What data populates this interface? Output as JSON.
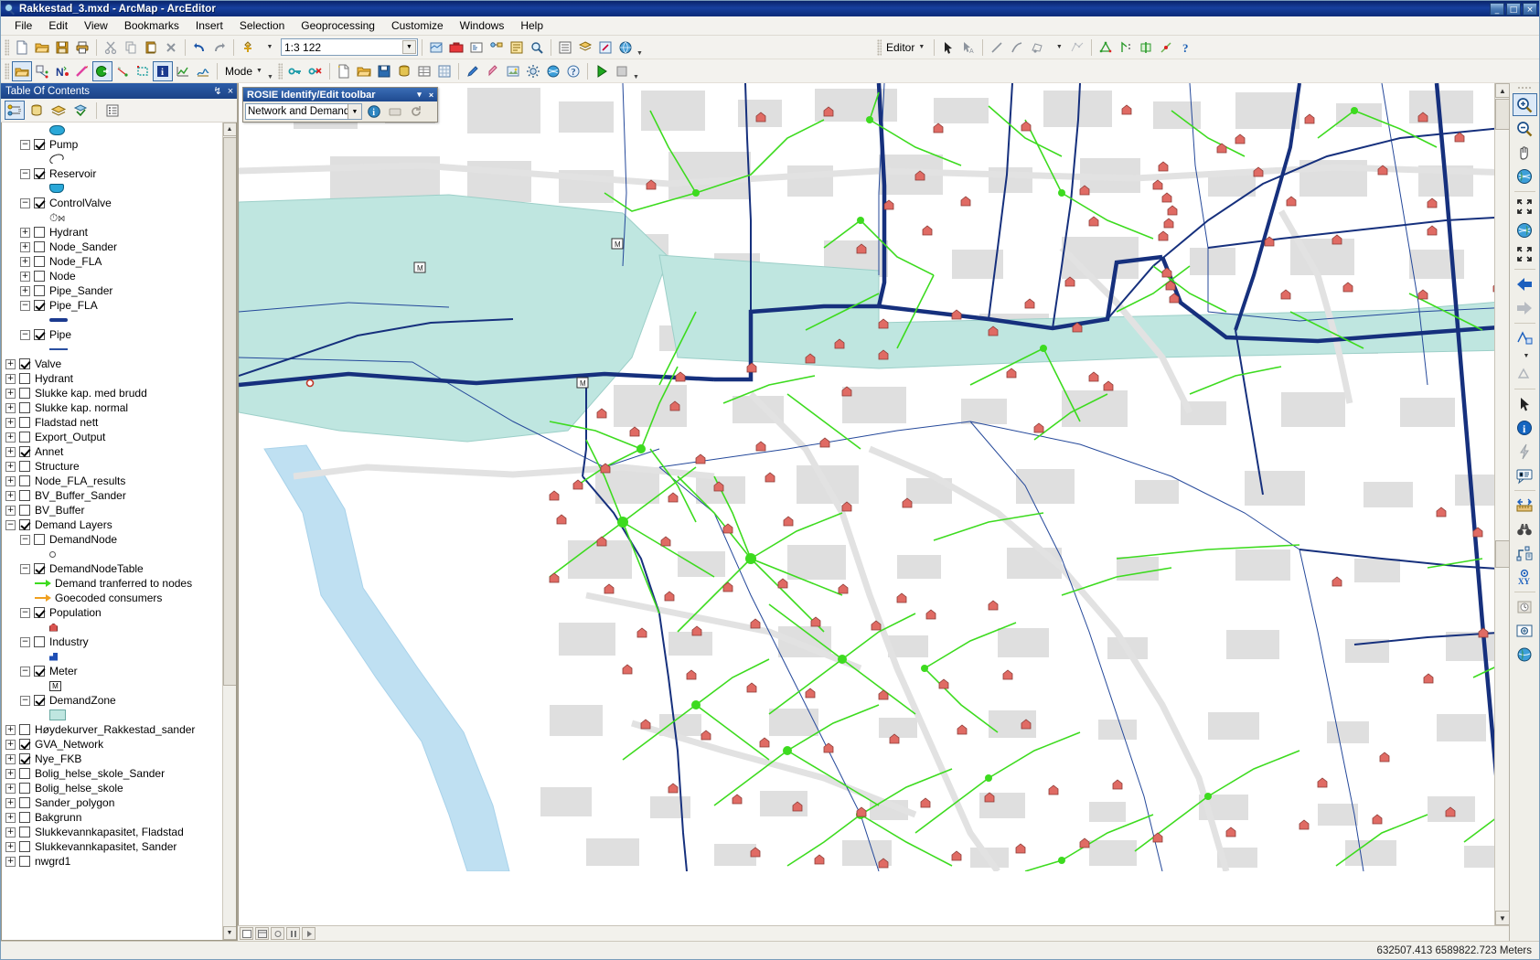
{
  "window": {
    "title": "Rakkestad_3.mxd - ArcMap - ArcEditor",
    "minimize": "_",
    "maximize": "□",
    "close": "×"
  },
  "menubar": {
    "items": [
      {
        "label": "File"
      },
      {
        "label": "Edit"
      },
      {
        "label": "View"
      },
      {
        "label": "Bookmarks"
      },
      {
        "label": "Insert"
      },
      {
        "label": "Selection"
      },
      {
        "label": "Geoprocessing"
      },
      {
        "label": "Customize"
      },
      {
        "label": "Windows"
      },
      {
        "label": "Help"
      }
    ]
  },
  "standard_toolbar": {
    "scale_value": "1:3 122",
    "buttons": [
      {
        "name": "new-document-icon"
      },
      {
        "name": "open-document-icon"
      },
      {
        "name": "save-icon"
      },
      {
        "name": "print-icon"
      },
      {
        "name": "cut-icon"
      },
      {
        "name": "copy-icon"
      },
      {
        "name": "paste-icon"
      },
      {
        "name": "delete-icon"
      },
      {
        "name": "undo-icon"
      },
      {
        "name": "redo-icon"
      },
      {
        "name": "add-data-icon"
      }
    ]
  },
  "editor_toolbar": {
    "editor_label": "Editor",
    "buttons": [
      {
        "name": "edit-tool-icon"
      },
      {
        "name": "edit-annotation-icon"
      },
      {
        "name": "straight-segment-icon"
      },
      {
        "name": "endpoint-arc-icon"
      },
      {
        "name": "trace-icon"
      },
      {
        "name": "sketch-properties-icon"
      },
      {
        "name": "edit-vertices-icon"
      },
      {
        "name": "reshape-feature-icon"
      },
      {
        "name": "cut-polygons-icon"
      },
      {
        "name": "split-icon"
      },
      {
        "name": "editor-help-icon"
      }
    ]
  },
  "rosie_toolbar": {
    "mode_label": "Mode",
    "buttons": [
      {
        "name": "open-network-icon"
      },
      {
        "name": "network-edit-icon"
      },
      {
        "name": "node-tool-icon"
      },
      {
        "name": "demand-tool-icon"
      },
      {
        "name": "run-export-icon"
      },
      {
        "name": "link-tool-icon"
      },
      {
        "name": "zone-tool-icon"
      },
      {
        "name": "info-tool-icon"
      },
      {
        "name": "chart-tool-icon"
      },
      {
        "name": "profile-tool-icon"
      }
    ],
    "second_group": [
      {
        "name": "key-icon"
      },
      {
        "name": "key-delete-icon"
      },
      {
        "name": "new-file-icon"
      },
      {
        "name": "open-folder-icon"
      },
      {
        "name": "save-as-icon"
      },
      {
        "name": "database-icon"
      },
      {
        "name": "table-icon"
      },
      {
        "name": "grid-icon"
      },
      {
        "name": "pencil-icon"
      },
      {
        "name": "marker-icon"
      },
      {
        "name": "image-icon"
      },
      {
        "name": "settings-icon"
      },
      {
        "name": "globe-icon"
      },
      {
        "name": "help-icon"
      },
      {
        "name": "run-icon"
      },
      {
        "name": "stop-icon"
      }
    ]
  },
  "toc": {
    "title": "Table Of Contents",
    "pin_icon": "↯",
    "close_icon": "×",
    "tabs": [
      {
        "name": "list-by-drawing-order",
        "selected": true
      },
      {
        "name": "list-by-source",
        "selected": false
      },
      {
        "name": "list-by-visibility",
        "selected": false
      },
      {
        "name": "list-by-selection",
        "selected": false
      },
      {
        "name": "options",
        "selected": false
      }
    ],
    "items": [
      {
        "label": "",
        "symbol": "pump-symbol",
        "kind": "symbol",
        "indent": 3
      },
      {
        "label": "Pump",
        "expander": "minus",
        "checked": true,
        "indent": 1
      },
      {
        "label": "",
        "symbol": "reservoir-symbol",
        "kind": "symbol",
        "indent": 3
      },
      {
        "label": "Reservoir",
        "expander": "minus",
        "checked": true,
        "indent": 1
      },
      {
        "label": "",
        "symbol": "controlvalve-symbol",
        "kind": "symbol",
        "indent": 3
      },
      {
        "label": "ControlValve",
        "expander": "minus",
        "checked": true,
        "indent": 1
      },
      {
        "label": "",
        "symbol": "bowtie-symbol",
        "kind": "symbol",
        "indent": 3
      },
      {
        "label": "Hydrant",
        "expander": "plus",
        "checked": false,
        "indent": 1
      },
      {
        "label": "Node_Sander",
        "expander": "plus",
        "checked": false,
        "indent": 1
      },
      {
        "label": "Node_FLA",
        "expander": "plus",
        "checked": false,
        "indent": 1
      },
      {
        "label": "Node",
        "expander": "plus",
        "checked": false,
        "indent": 1
      },
      {
        "label": "Pipe_Sander",
        "expander": "plus",
        "checked": false,
        "indent": 1
      },
      {
        "label": "Pipe_FLA",
        "expander": "minus",
        "checked": true,
        "indent": 1
      },
      {
        "label": "",
        "symbol": "pipe-fla-symbol",
        "kind": "symbol",
        "indent": 3
      },
      {
        "label": "Pipe",
        "expander": "minus",
        "checked": true,
        "indent": 1
      },
      {
        "label": "",
        "symbol": "pipe-symbol",
        "kind": "symbol",
        "indent": 3
      },
      {
        "label": "Valve",
        "expander": "plus",
        "checked": true,
        "indent": 0
      },
      {
        "label": "Hydrant",
        "expander": "plus",
        "checked": false,
        "indent": 0
      },
      {
        "label": "Slukke kap. med brudd",
        "expander": "plus",
        "checked": false,
        "indent": 0
      },
      {
        "label": "Slukke kap. normal",
        "expander": "plus",
        "checked": false,
        "indent": 0
      },
      {
        "label": "Fladstad nett",
        "expander": "plus",
        "checked": false,
        "indent": 0
      },
      {
        "label": "Export_Output",
        "expander": "plus",
        "checked": false,
        "indent": 0
      },
      {
        "label": "Annet",
        "expander": "plus",
        "checked": true,
        "indent": 0
      },
      {
        "label": "Structure",
        "expander": "plus",
        "checked": false,
        "indent": 0
      },
      {
        "label": "Node_FLA_results",
        "expander": "plus",
        "checked": false,
        "indent": 0
      },
      {
        "label": "BV_Buffer_Sander",
        "expander": "plus",
        "checked": false,
        "indent": 0
      },
      {
        "label": "BV_Buffer",
        "expander": "plus",
        "checked": false,
        "indent": 0
      },
      {
        "label": "Demand Layers",
        "expander": "minus",
        "checked": true,
        "indent": 0
      },
      {
        "label": "DemandNode",
        "expander": "minus",
        "checked": false,
        "indent": 1
      },
      {
        "label": "",
        "symbol": "circle-symbol",
        "kind": "symbol",
        "indent": 3
      },
      {
        "label": "DemandNodeTable",
        "expander": "minus",
        "checked": true,
        "indent": 1
      },
      {
        "label": "Demand tranferred to nodes",
        "kind": "legend",
        "symbol": "green-arrow-symbol",
        "indent": 2
      },
      {
        "label": "Goecoded consumers",
        "kind": "legend",
        "symbol": "orange-arrow-symbol",
        "indent": 2
      },
      {
        "label": "Population",
        "expander": "minus",
        "checked": true,
        "indent": 1
      },
      {
        "label": "",
        "symbol": "house-symbol",
        "kind": "symbol",
        "indent": 3
      },
      {
        "label": "Industry",
        "expander": "minus",
        "checked": false,
        "indent": 1
      },
      {
        "label": "",
        "symbol": "industry-symbol",
        "kind": "symbol",
        "indent": 3
      },
      {
        "label": "Meter",
        "expander": "minus",
        "checked": true,
        "indent": 1
      },
      {
        "label": "",
        "symbol": "meter-symbol",
        "kind": "symbol",
        "indent": 3
      },
      {
        "label": "DemandZone",
        "expander": "minus",
        "checked": true,
        "indent": 1
      },
      {
        "label": "",
        "symbol": "zone-symbol",
        "kind": "symbol",
        "indent": 3
      },
      {
        "label": "Høydekurver_Rakkestad_sander",
        "expander": "plus",
        "checked": false,
        "indent": 0
      },
      {
        "label": "GVA_Network",
        "expander": "plus",
        "checked": true,
        "indent": 0
      },
      {
        "label": "Nye_FKB",
        "expander": "plus",
        "checked": true,
        "indent": 0
      },
      {
        "label": "Bolig_helse_skole_Sander",
        "expander": "plus",
        "checked": false,
        "indent": 0
      },
      {
        "label": "Bolig_helse_skole",
        "expander": "plus",
        "checked": false,
        "indent": 0
      },
      {
        "label": "Sander_polygon",
        "expander": "plus",
        "checked": false,
        "indent": 0
      },
      {
        "label": "Bakgrunn",
        "expander": "plus",
        "checked": false,
        "indent": 0
      },
      {
        "label": "Slukkevannkapasitet, Fladstad",
        "expander": "plus",
        "checked": false,
        "indent": 0
      },
      {
        "label": "Slukkevannkapasitet, Sander",
        "expander": "plus",
        "checked": false,
        "indent": 0
      },
      {
        "label": "nwgrd1",
        "expander": "plus",
        "checked": false,
        "indent": 0
      }
    ]
  },
  "rosie_float": {
    "title": "ROSIE Identify/Edit  toolbar",
    "minimize_icon": "▾",
    "close_icon": "×",
    "layer_selector_value": "Network and Demand layer",
    "buttons": [
      {
        "name": "identify-icon"
      },
      {
        "name": "edit-attributes-icon"
      },
      {
        "name": "refresh-icon"
      }
    ]
  },
  "right_palette": {
    "tools": [
      {
        "name": "zoom-in-icon",
        "selected": true
      },
      {
        "name": "zoom-out-icon",
        "selected": false
      },
      {
        "name": "pan-icon",
        "selected": false
      },
      {
        "name": "full-extent-globe-icon",
        "selected": false
      },
      {
        "name": "fixed-zoom-in-icon",
        "selected": false
      },
      {
        "name": "globe-extent-icon",
        "selected": false
      },
      {
        "name": "fixed-zoom-out-icon",
        "selected": false
      },
      {
        "name": "go-back-extent-icon",
        "selected": false
      },
      {
        "name": "go-forward-extent-icon",
        "selected": false
      },
      {
        "name": "select-features-icon",
        "selected": false
      },
      {
        "name": "clear-selection-icon",
        "selected": false
      },
      {
        "name": "select-elements-icon",
        "selected": false
      },
      {
        "name": "identify-info-icon",
        "selected": false
      },
      {
        "name": "hyperlink-icon",
        "selected": false
      },
      {
        "name": "html-popup-icon",
        "selected": false
      },
      {
        "name": "measure-icon",
        "selected": false
      },
      {
        "name": "find-binoculars-icon",
        "selected": false
      },
      {
        "name": "find-route-icon",
        "selected": false
      },
      {
        "name": "go-to-xy-icon",
        "selected": false
      },
      {
        "name": "time-slider-icon",
        "selected": false
      },
      {
        "name": "create-viewer-window-icon",
        "selected": false
      },
      {
        "name": "globe-view-icon",
        "selected": false
      }
    ]
  },
  "statusbar": {
    "coordinates": "632507.413  6589822.723 Meters"
  },
  "map": {
    "background_color": "#ffffff",
    "building_color": "#dcdcdc",
    "water_color": "#bfe6e0",
    "river_color": "#bfe0f2",
    "pipe_color": "#16307d",
    "demand_color": "#3ddb1f",
    "house_color": "#e06b64"
  }
}
